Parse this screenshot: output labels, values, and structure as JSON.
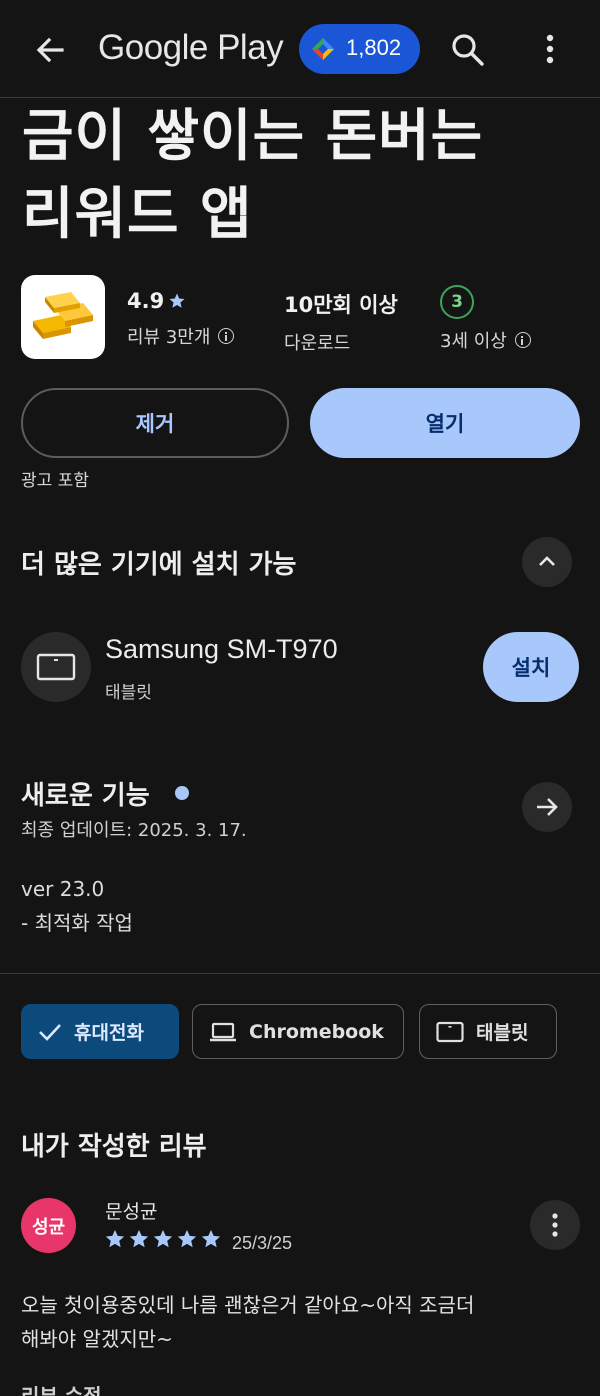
{
  "header": {
    "brand": "Google Play",
    "points": "1,802",
    "icons": [
      "back-arrow-icon",
      "play-points-icon",
      "search-icon",
      "more-vert-icon"
    ]
  },
  "app": {
    "title_line1": "금이 쌓이는 돈버는",
    "title_line2": "리워드 앱",
    "rating": "4.9",
    "reviews_label": "리뷰 3만개",
    "downloads": "10만회 이상",
    "downloads_label": "다운로드",
    "age_rating": "3",
    "age_label": "3세 이상",
    "remove_label": "제거",
    "open_label": "열기",
    "ads_label": "광고 포함"
  },
  "devices": {
    "title": "더 많은 기기에 설치 가능",
    "device_name": "Samsung SM-T970",
    "device_type": "태블릿",
    "install_label": "설치"
  },
  "whats_new": {
    "title": "새로운 기능",
    "updated": "최종 업데이트: 2025. 3. 17.",
    "notes_line1": "ver 23.0",
    "notes_line2": "- 최적화 작업"
  },
  "chips": [
    {
      "label": "휴대전화",
      "icon": "check-icon",
      "selected": true
    },
    {
      "label": "Chromebook",
      "icon": "laptop-icon",
      "selected": false
    },
    {
      "label": "태블릿",
      "icon": "tablet-icon",
      "selected": false
    }
  ],
  "my_review": {
    "title": "내가 작성한 리뷰",
    "avatar_text": "성균",
    "reviewer": "문성균",
    "stars": 5,
    "date": "25/3/25",
    "text_line1": "오늘 첫이용중있데 나름 괜찮은거 같아요~아직 조금더",
    "text_line2": "해봐야 알겠지만~",
    "edit_label": "리뷰 수정"
  },
  "colors": {
    "background": "#141414",
    "accent": "#a8c7fa",
    "points_pill": "#1a56d6",
    "chip_selected": "#0d4a7c",
    "avatar": "#e8356a",
    "age_badge": "#3fa35a"
  }
}
